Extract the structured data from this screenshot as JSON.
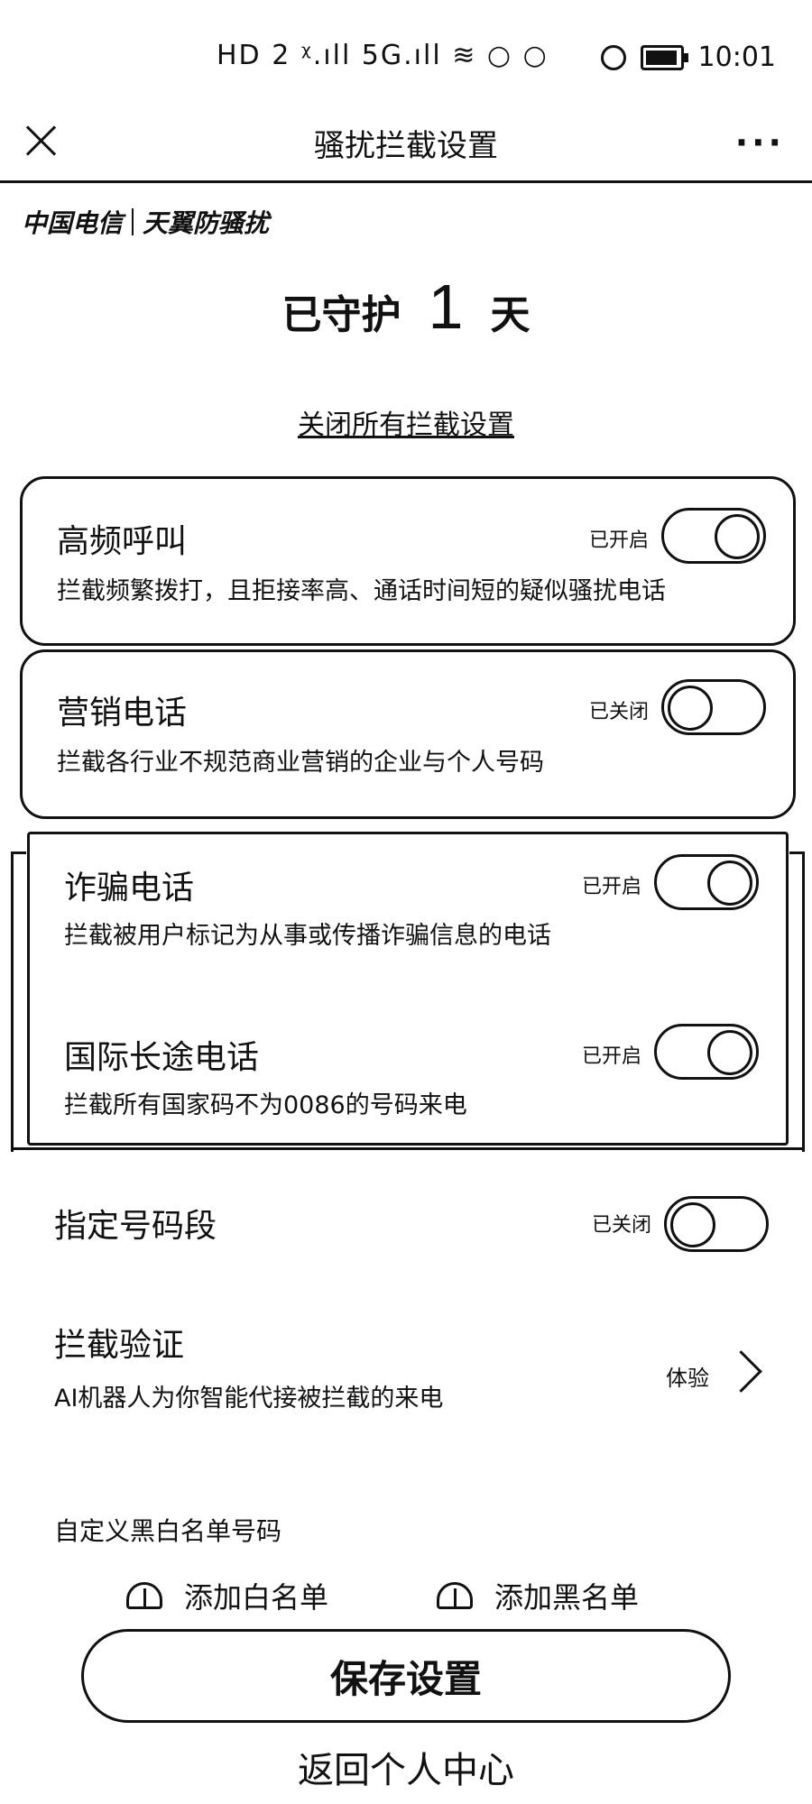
{
  "status_bar": {
    "icons_text": "HD 2 ᵡ.ıll 5G.ıll ≋ ○ ○",
    "time": "10:01"
  },
  "nav": {
    "title": "骚扰拦截设置",
    "more": "···"
  },
  "brand": {
    "carrier": "中国电信",
    "product": "天翼防骚扰"
  },
  "guard": {
    "prefix": "已守护",
    "days": "1",
    "suffix": "天"
  },
  "close_all_label": "关闭所有拦截设置",
  "items": [
    {
      "title": "高频呼叫",
      "desc": "拦截频繁拨打，且拒接率高、通话时间短的疑似骚扰电话",
      "status": "已开启",
      "on": true
    },
    {
      "title": "营销电话",
      "desc": "拦截各行业不规范商业营销的企业与个人号码",
      "status": "已关闭",
      "on": false
    },
    {
      "title": "诈骗电话",
      "desc": "拦截被用户标记为从事或传播诈骗信息的电话",
      "status": "已开启",
      "on": true
    },
    {
      "title": "国际长途电话",
      "desc": "拦截所有国家码不为0086的号码来电",
      "status": "已开启",
      "on": true
    },
    {
      "title": "指定号码段",
      "status": "已关闭",
      "on": false
    }
  ],
  "verify": {
    "title": "拦截验证",
    "desc": "AI机器人为你智能代接被拦截的来电",
    "action": "体验"
  },
  "custom_list": {
    "label": "自定义黑白名单号码",
    "add_white": "添加白名单",
    "add_black": "添加黑名单"
  },
  "save_label": "保存设置",
  "back_label": "返回个人中心"
}
